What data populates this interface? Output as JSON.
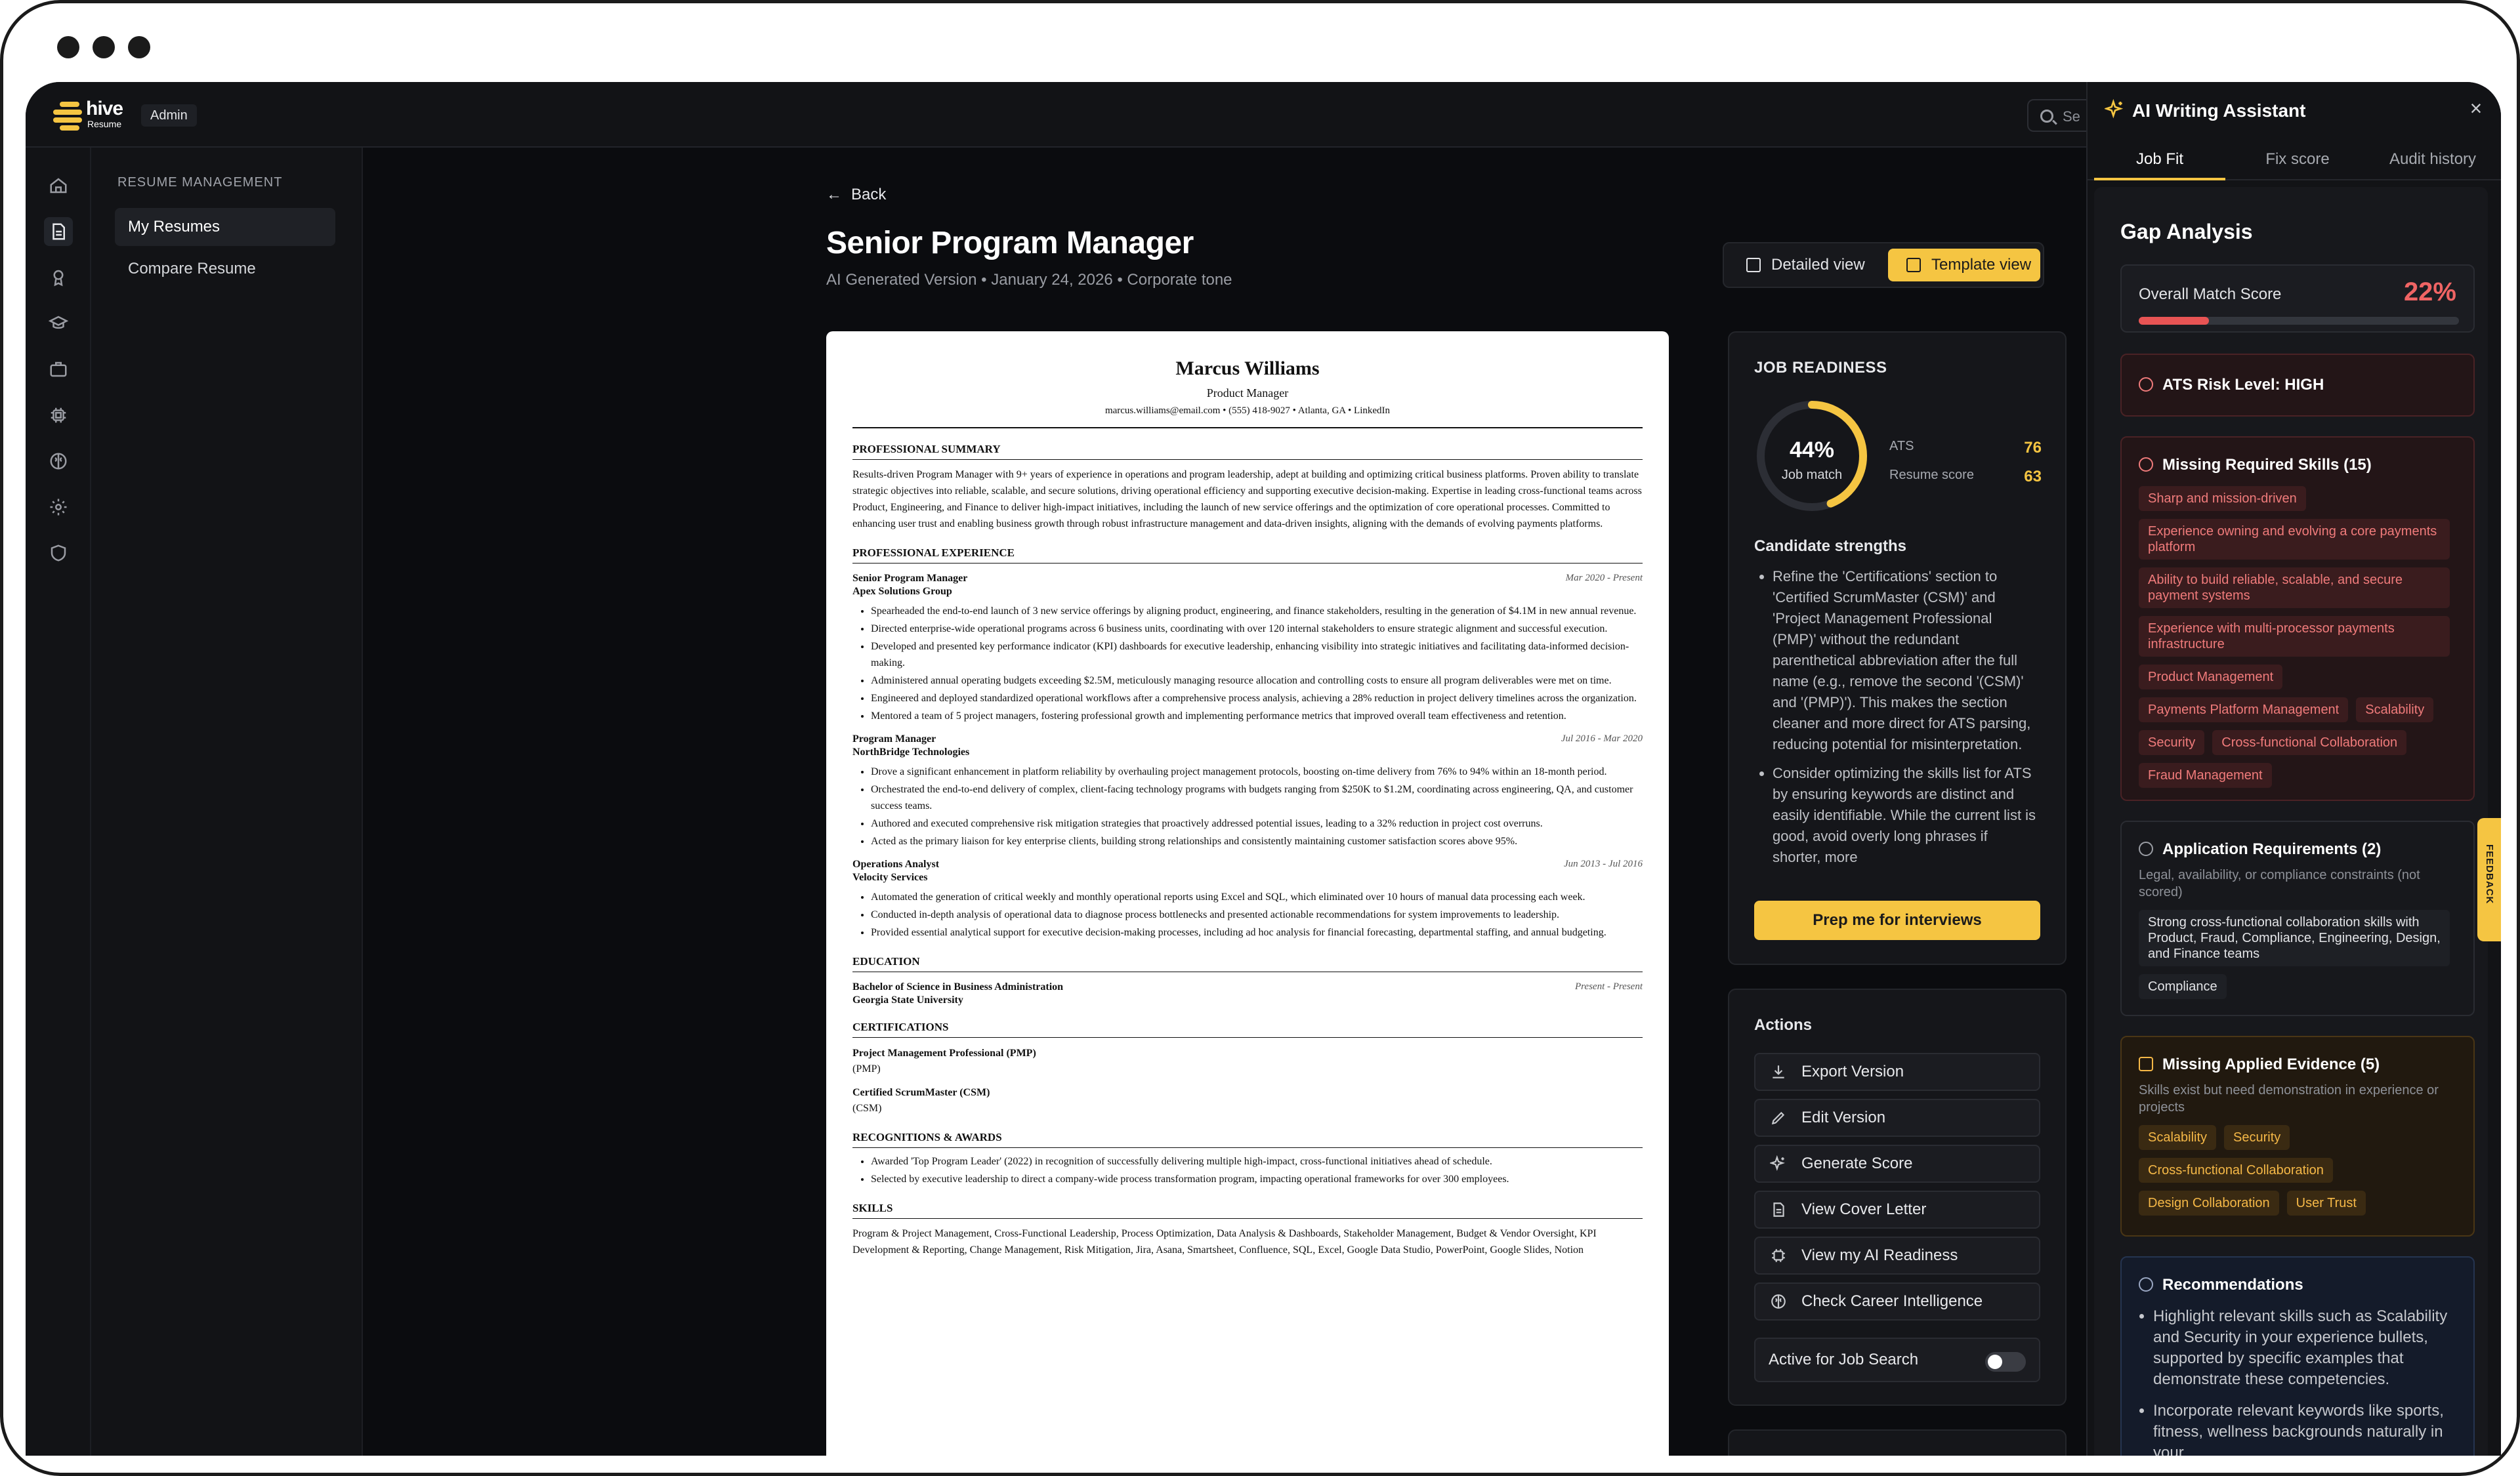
{
  "brand": {
    "name": "hive",
    "sub": "Resume",
    "role_badge": "Admin"
  },
  "search": {
    "placeholder": "Se"
  },
  "submenu": {
    "heading": "RESUME MANAGEMENT",
    "items": [
      "My Resumes",
      "Compare Resume"
    ]
  },
  "page": {
    "back_label": "Back",
    "title": "Senior Program Manager",
    "subtitle": "AI Generated Version • January 24, 2026 • Corporate tone",
    "view_detailed": "Detailed view",
    "view_template": "Template view"
  },
  "resume": {
    "name": "Marcus Williams",
    "role": "Product Manager",
    "contact": "marcus.williams@email.com • (555) 418-9027 • Atlanta, GA • LinkedIn",
    "summary_heading": "PROFESSIONAL SUMMARY",
    "summary": "Results-driven Program Manager with 9+ years of experience in operations and program leadership, adept at building and optimizing critical business platforms. Proven ability to translate strategic objectives into reliable, scalable, and secure solutions, driving operational efficiency and supporting executive decision-making. Expertise in leading cross-functional teams across Product, Engineering, and Finance to deliver high-impact initiatives, including the launch of new service offerings and the optimization of core operational processes. Committed to enhancing user trust and enabling business growth through robust infrastructure management and data-driven insights, aligning with the demands of evolving payments platforms.",
    "experience_heading": "PROFESSIONAL EXPERIENCE",
    "jobs": [
      {
        "title": "Senior Program Manager",
        "company": "Apex Solutions Group",
        "dates": "Mar 2020 - Present",
        "bullets": [
          "Spearheaded the end-to-end launch of 3 new service offerings by aligning product, engineering, and finance stakeholders, resulting in the generation of $4.1M in new annual revenue.",
          "Directed enterprise-wide operational programs across 6 business units, coordinating with over 120 internal stakeholders to ensure strategic alignment and successful execution.",
          "Developed and presented key performance indicator (KPI) dashboards for executive leadership, enhancing visibility into strategic initiatives and facilitating data-informed decision-making.",
          "Administered annual operating budgets exceeding $2.5M, meticulously managing resource allocation and controlling costs to ensure all program deliverables were met on time.",
          "Engineered and deployed standardized operational workflows after a comprehensive process analysis, achieving a 28% reduction in project delivery timelines across the organization.",
          "Mentored a team of 5 project managers, fostering professional growth and implementing performance metrics that improved overall team effectiveness and retention."
        ]
      },
      {
        "title": "Program Manager",
        "company": "NorthBridge Technologies",
        "dates": "Jul 2016 - Mar 2020",
        "bullets": [
          "Drove a significant enhancement in platform reliability by overhauling project management protocols, boosting on-time delivery from 76% to 94% within an 18-month period.",
          "Orchestrated the end-to-end delivery of complex, client-facing technology programs with budgets ranging from $250K to $1.2M, coordinating across engineering, QA, and customer success teams.",
          "Authored and executed comprehensive risk mitigation strategies that proactively addressed potential issues, leading to a 32% reduction in project cost overruns.",
          "Acted as the primary liaison for key enterprise clients, building strong relationships and consistently maintaining customer satisfaction scores above 95%."
        ]
      },
      {
        "title": "Operations Analyst",
        "company": "Velocity Services",
        "dates": "Jun 2013 - Jul 2016",
        "bullets": [
          "Automated the generation of critical weekly and monthly operational reports using Excel and SQL, which eliminated over 10 hours of manual data processing each week.",
          "Conducted in-depth analysis of operational data to diagnose process bottlenecks and presented actionable recommendations for system improvements to leadership.",
          "Provided essential analytical support for executive decision-making processes, including ad hoc analysis for financial forecasting, departmental staffing, and annual budgeting."
        ]
      }
    ],
    "education_heading": "EDUCATION",
    "education": {
      "degree": "Bachelor of Science in Business Administration",
      "school": "Georgia State University",
      "dates": "Present - Present"
    },
    "certs_heading": "CERTIFICATIONS",
    "certs": [
      {
        "name": "Project Management Professional (PMP)",
        "abbr": "(PMP)"
      },
      {
        "name": "Certified ScrumMaster (CSM)",
        "abbr": "(CSM)"
      }
    ],
    "awards_heading": "RECOGNITIONS & AWARDS",
    "awards": [
      "Awarded 'Top Program Leader' (2022) in recognition of successfully delivering multiple high-impact, cross-functional initiatives ahead of schedule.",
      "Selected by executive leadership to direct a company-wide process transformation program, impacting operational frameworks for over 300 employees."
    ],
    "skills_heading": "SKILLS",
    "skills": "Program & Project Management, Cross-Functional Leadership, Process Optimization, Data Analysis & Dashboards, Stakeholder Management, Budget & Vendor Oversight, KPI Development & Reporting, Change Management, Risk Mitigation, Jira, Asana, Smartsheet, Confluence, SQL, Excel, Google Data Studio, PowerPoint, Google Slides, Notion"
  },
  "readiness": {
    "title": "JOB READINESS",
    "job_match_pct": 44,
    "job_match_text": "44%",
    "job_match_label": "Job match",
    "ats_label": "ATS",
    "ats_value": "76",
    "resume_score_label": "Resume score",
    "resume_score_value": "63",
    "strengths_title": "Candidate strengths",
    "strengths": [
      "Refine the 'Certifications' section to 'Certified ScrumMaster (CSM)' and 'Project Management Professional (PMP)' without the redundant parenthetical abbreviation after the full name (e.g., remove the second '(CSM)' and '(PMP)'). This makes the section cleaner and more direct for ATS parsing, reducing potential for misinterpretation.",
      "Consider optimizing the skills list for ATS by ensuring keywords are distinct and easily identifiable. While the current list is good, avoid overly long phrases if shorter, more"
    ],
    "prep_button": "Prep me for interviews"
  },
  "actions": {
    "title": "Actions",
    "buttons": [
      "Export Version",
      "Edit Version",
      "Generate Score",
      "View Cover Letter",
      "View my AI Readiness",
      "Check Career Intelligence"
    ],
    "toggle_label": "Active for Job Search"
  },
  "ai": {
    "title": "AI Writing Assistant",
    "tabs": [
      "Job Fit",
      "Fix score",
      "Audit history"
    ],
    "gap_title": "Gap Analysis",
    "overall_label": "Overall Match Score",
    "overall_value": "22%",
    "overall_pct": 22,
    "ats_risk": "ATS Risk Level: HIGH",
    "missing_title": "Missing Required Skills (15)",
    "missing_skills": [
      "Sharp and mission-driven",
      "Experience owning and evolving a core payments platform",
      "Ability to build reliable, scalable, and secure payment systems",
      "Experience with multi-processor payments infrastructure",
      "Product Management",
      "Payments Platform Management",
      "Scalability",
      "Security",
      "Cross-functional Collaboration",
      "Fraud Management"
    ],
    "app_req_title": "Application Requirements (2)",
    "app_req_desc": "Legal, availability, or compliance constraints (not scored)",
    "app_req_items": [
      "Strong cross-functional collaboration skills with Product, Fraud, Compliance, Engineering, Design, and Finance teams",
      "Compliance"
    ],
    "evidence_title": "Missing Applied Evidence (5)",
    "evidence_desc": "Skills exist but need demonstration in experience or projects",
    "evidence_items": [
      "Scalability",
      "Security",
      "Cross-functional Collaboration",
      "Design Collaboration",
      "User Trust"
    ],
    "rec_title": "Recommendations",
    "recs": [
      "Highlight relevant skills such as Scalability and Security in your experience bullets, supported by specific examples that demonstrate these competencies.",
      "Incorporate relevant keywords like sports, fitness, wellness backgrounds naturally in your"
    ]
  },
  "feedback_tab": "FEEDBACK",
  "colors": {
    "accent": "#f5c542",
    "danger": "#e85454",
    "bg": "#0b0c0f"
  }
}
